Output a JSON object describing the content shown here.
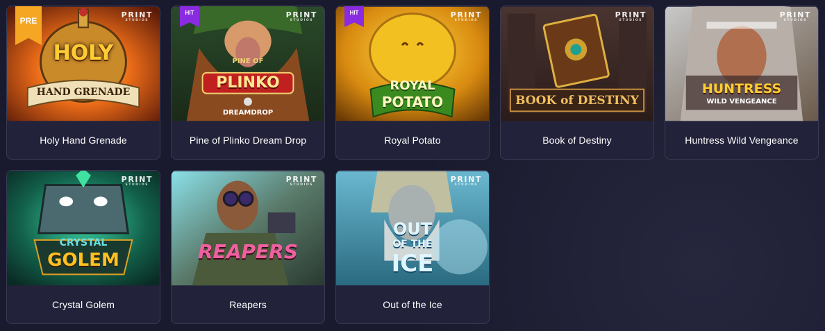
{
  "studio": {
    "name": "PRINT",
    "sub": "STUDIOS"
  },
  "badges": {
    "pre": "PRE",
    "hit": "HIT"
  },
  "games": [
    {
      "title": "Holy Hand Grenade",
      "logo_line1": "HOLY",
      "logo_line2": "HAND GRENADE",
      "badge": "pre"
    },
    {
      "title": "Pine of Plinko Dream Drop",
      "logo_line1": "PINE OF",
      "logo_line2": "PLINKO",
      "logo_line3": "DREAMDROP",
      "badge": "hit"
    },
    {
      "title": "Royal Potato",
      "logo_line1": "ROYAL",
      "logo_line2": "POTATO",
      "badge": "hit"
    },
    {
      "title": "Book of Destiny",
      "logo_line1": "BOOK of DESTINY",
      "badge": null
    },
    {
      "title": "Huntress Wild Vengeance",
      "logo_line1": "HUNTRESS",
      "logo_line2": "WILD VENGEANCE",
      "badge": null
    },
    {
      "title": "Crystal Golem",
      "logo_line1": "CRYSTAL",
      "logo_line2": "GOLEM",
      "badge": null
    },
    {
      "title": "Reapers",
      "logo_line1": "REAPERS",
      "badge": null
    },
    {
      "title": "Out of the Ice",
      "logo_line1": "OUT",
      "logo_line2": "OF THE",
      "logo_line3": "ICE",
      "badge": null
    }
  ],
  "colors": {
    "background": "#1a1a2e",
    "card": "#22223a",
    "pre_badge": "#f5a623",
    "hit_badge": "#8a2be2"
  }
}
